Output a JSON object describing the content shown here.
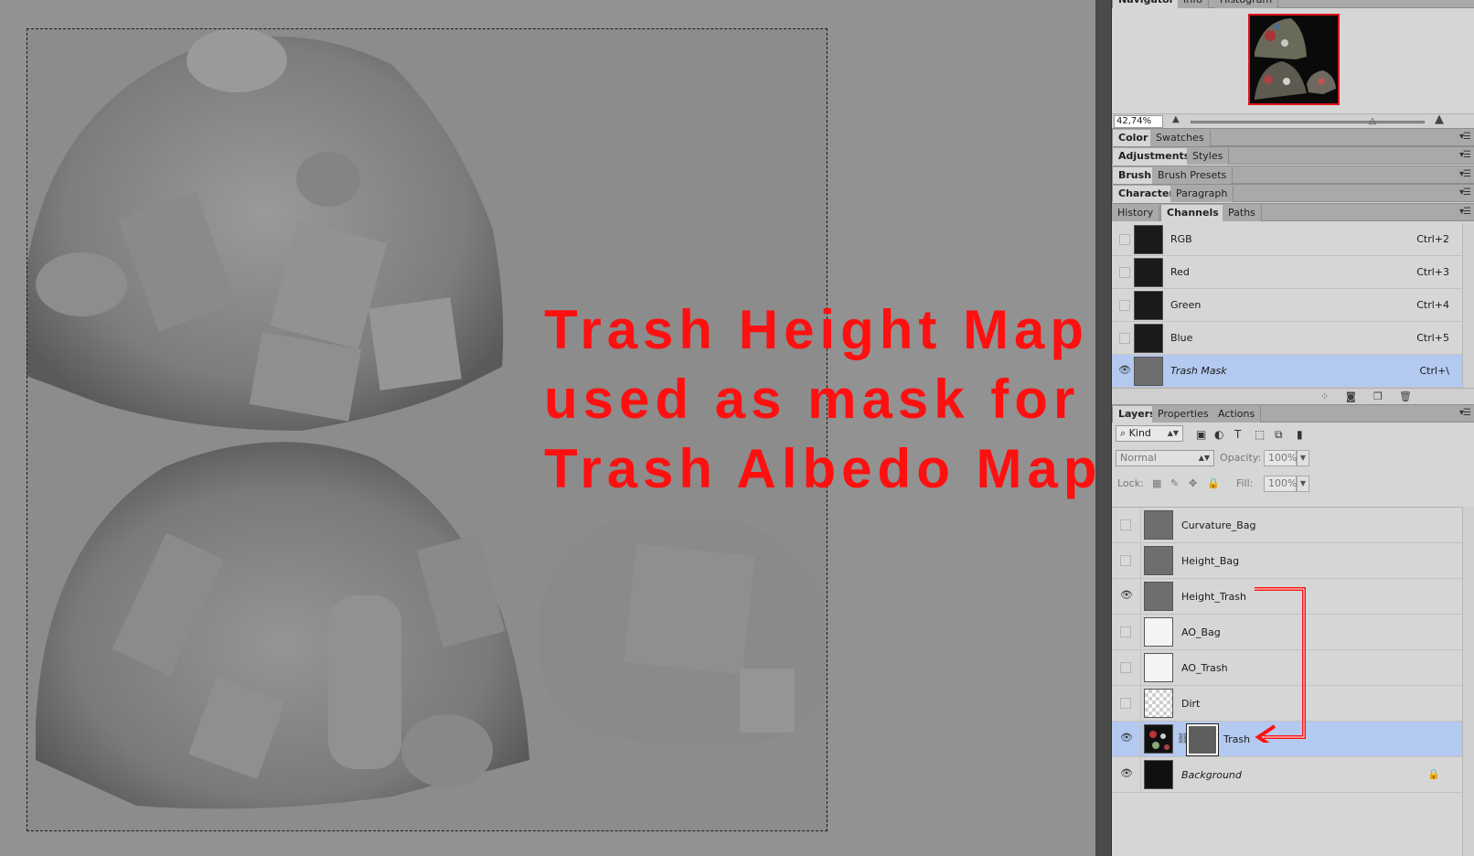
{
  "annotation": {
    "lines": [
      "Trash Height Map",
      "used as mask for",
      "Trash Albedo Map"
    ],
    "color": "#ff1010"
  },
  "navigator": {
    "tabs": [
      "Navigator",
      "Info",
      "Histogram"
    ],
    "zoom_value": "42,74%",
    "icons": {
      "zoom_out": "small-mountain-icon",
      "zoom_in": "large-mountain-icon"
    }
  },
  "panel_groups": [
    {
      "tabs": [
        "Color",
        "Swatches"
      ]
    },
    {
      "tabs": [
        "Adjustments",
        "Styles"
      ]
    },
    {
      "tabs": [
        "Brush",
        "Brush Presets"
      ]
    },
    {
      "tabs": [
        "Character",
        "Paragraph"
      ]
    }
  ],
  "channels_panel": {
    "tabs": [
      "History",
      "Channels",
      "Paths"
    ],
    "active_tab": "Channels",
    "channels": [
      {
        "name": "RGB",
        "shortcut": "Ctrl+2",
        "visible": false
      },
      {
        "name": "Red",
        "shortcut": "Ctrl+3",
        "visible": false
      },
      {
        "name": "Green",
        "shortcut": "Ctrl+4",
        "visible": false
      },
      {
        "name": "Blue",
        "shortcut": "Ctrl+5",
        "visible": false
      },
      {
        "name": "Trash Mask",
        "shortcut": "Ctrl+\\",
        "visible": true,
        "selected": true
      }
    ]
  },
  "layers_panel": {
    "tabs": [
      "Layers",
      "Properties",
      "Actions"
    ],
    "active_tab": "Layers",
    "filter_kind": "Kind",
    "blend_mode": "Normal",
    "opacity_label": "Opacity:",
    "opacity_value": "100%",
    "lock_label": "Lock:",
    "fill_label": "Fill:",
    "fill_value": "100%",
    "layers": [
      {
        "name": "Curvature_Bag",
        "visible": false,
        "thumb": "grey"
      },
      {
        "name": "Height_Bag",
        "visible": false,
        "thumb": "grey"
      },
      {
        "name": "Height_Trash",
        "visible": true,
        "thumb": "grey"
      },
      {
        "name": "AO_Bag",
        "visible": false,
        "thumb": "white"
      },
      {
        "name": "AO_Trash",
        "visible": false,
        "thumb": "white"
      },
      {
        "name": "Dirt",
        "visible": false,
        "thumb": "transparent"
      },
      {
        "name": "Trash",
        "visible": true,
        "thumb": "albedo",
        "has_mask": true,
        "selected": true
      },
      {
        "name": "Background",
        "visible": true,
        "thumb": "dark",
        "locked": true
      }
    ]
  },
  "colors": {
    "accent_selection": "#b4c9f0",
    "annotation_red": "#ff1010",
    "panel_bg": "#d6d6d6"
  }
}
